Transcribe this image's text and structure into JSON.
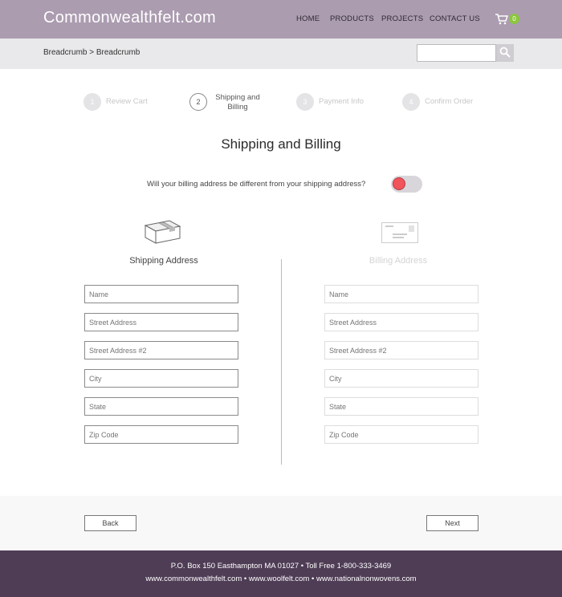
{
  "header": {
    "logo": "Commonwealthfelt.com",
    "nav": [
      "HOME",
      "PRODUCTS",
      "PROJECTS",
      "CONTACT US"
    ],
    "cart_count": "0"
  },
  "subbar": {
    "breadcrumb": "Breadcrumb > Breadcrumb",
    "search_placeholder": ""
  },
  "steps": [
    {
      "num": "1",
      "label": "Review Cart",
      "active": false
    },
    {
      "num": "2",
      "label": "Shipping and Billing",
      "active": true
    },
    {
      "num": "3",
      "label": "Payment Info",
      "active": false
    },
    {
      "num": "4",
      "label": "Confirm Order",
      "active": false
    }
  ],
  "page_title": "Shipping and Billing",
  "billing_question": "Will your billing address be different from your shipping address?",
  "billing_toggle": {
    "state": "off",
    "color": "#f2545b"
  },
  "shipping": {
    "title": "Shipping Address",
    "fields": [
      "Name",
      "Street Address",
      "Street Address #2",
      "City",
      "State",
      "Zip Code"
    ]
  },
  "billing": {
    "title": "Billing Address",
    "fields": [
      "Name",
      "Street Address",
      "Street Address #2",
      "City",
      "State",
      "Zip Code"
    ]
  },
  "actions": {
    "back": "Back",
    "next": "Next"
  },
  "footer": {
    "line1": "P.O. Box 150 Easthampton MA 01027 • Toll Free 1-800-333-3469",
    "line2": "www.commonwealthfelt.com • www.woolfelt.com • www.nationalnonwovens.com"
  },
  "colors": {
    "header": "#ab9cb0",
    "footer": "#4f3d56",
    "badge": "#8cc63f"
  }
}
